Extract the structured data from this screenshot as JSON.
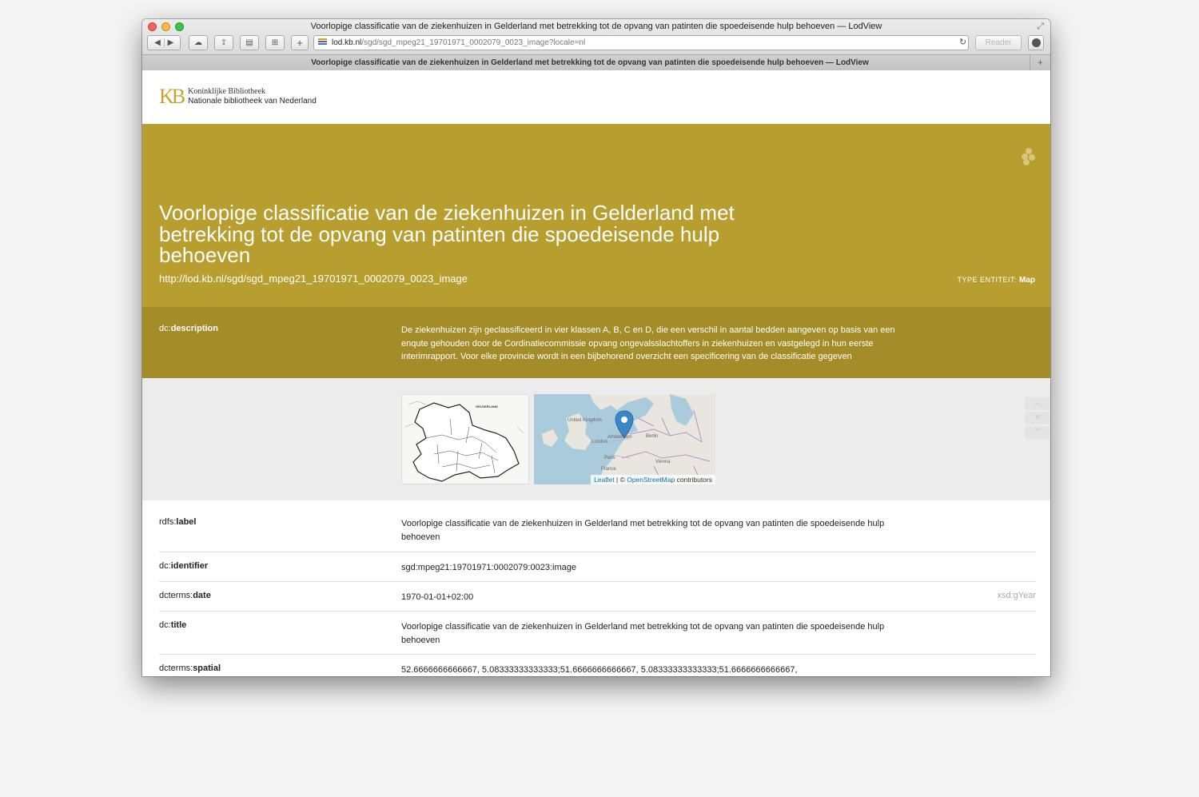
{
  "window": {
    "title": "Voorlopige classificatie van de ziekenhuizen in Gelderland met betrekking tot de opvang van patinten die spoedeisende hulp behoeven — LodView"
  },
  "toolbar": {
    "url_host": "lod.kb.nl",
    "url_path": "/sgd/sgd_mpeg21_19701971_0002079_0023_image?locale=nl",
    "reader_label": "Reader",
    "add_label": "+"
  },
  "tab": {
    "title": "Voorlopige classificatie van de ziekenhuizen in Gelderland met betrekking tot de opvang van patinten die spoedeisende hulp behoeven — LodView",
    "new_tab_label": "+"
  },
  "logo": {
    "mark": "KB",
    "line1": "Koninklijke Bibliotheek",
    "line2": "Nationale bibliotheek van Nederland"
  },
  "hero": {
    "title": "Voorlopige classificatie van de ziekenhuizen in Gelderland met betrekking tot de opvang van patinten die spoedeisende hulp behoeven",
    "uri": "http://lod.kb.nl/sgd/sgd_mpeg21_19701971_0002079_0023_image",
    "type_label": "TYPE ENTITEIT:",
    "type_value": "Map"
  },
  "description": {
    "prefix": "dc:",
    "name": "description",
    "value": "De ziekenhuizen zijn geclassificeerd in vier klassen A, B, C en D, die een verschil in aantal bedden aangeven op basis van een enqute gehouden door de Cordinatiecommissie opvang ongevalsslachtoffers in ziekenhuizen en vastgelegd in hun eerste interimrapport. Voor elke provincie wordt in een bijbehorend overzicht een specificering van de classificatie gegeven"
  },
  "media": {
    "thumb_label": "GELDERLAND",
    "map_labels": [
      "United Kingdom",
      "London",
      "Amsterdam",
      "Berlin",
      "Paris",
      "France",
      "Vienna"
    ],
    "attribution_leaflet": "Leaflet",
    "attribution_sep": " | © ",
    "attribution_osm": "OpenStreetMap",
    "attribution_tail": " contributors"
  },
  "properties": [
    {
      "prefix": "rdfs:",
      "name": "label",
      "value": "Voorlopige classificatie van de ziekenhuizen in Gelderland met betrekking tot de opvang van patinten die spoedeisende hulp behoeven",
      "type": ""
    },
    {
      "prefix": "dc:",
      "name": "identifier",
      "value": "sgd:mpeg21:19701971:0002079:0023:image",
      "type": ""
    },
    {
      "prefix": "dcterms:",
      "name": "date",
      "value": "1970-01-01+02:00",
      "type": "xsd:gYear"
    },
    {
      "prefix": "dc:",
      "name": "title",
      "value": "Voorlopige classificatie van de ziekenhuizen in Gelderland met betrekking tot de opvang van patinten die spoedeisende hulp behoeven",
      "type": ""
    },
    {
      "prefix": "dcterms:",
      "name": "spatial",
      "value": "52.6666666666667, 5.08333333333333;51.6666666666667, 5.08333333333333;51.6666666666667,",
      "type": ""
    }
  ]
}
